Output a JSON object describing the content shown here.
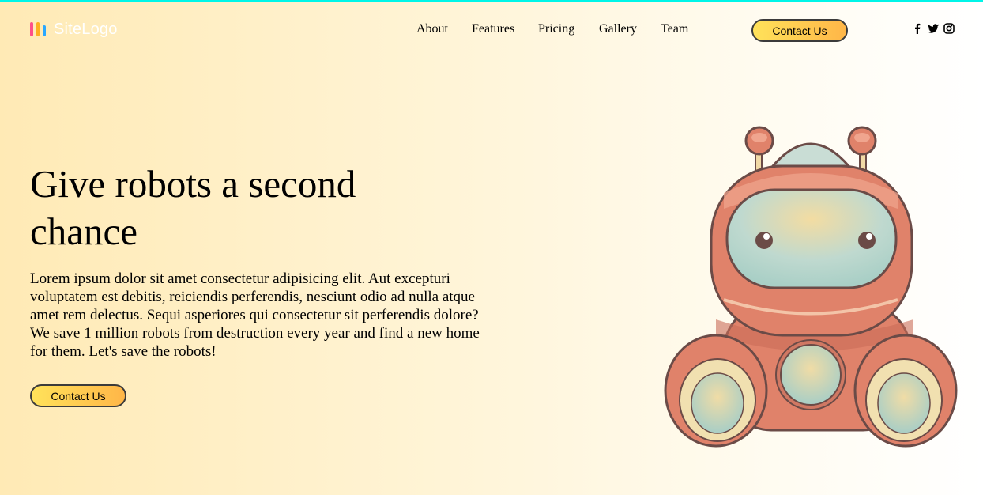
{
  "header": {
    "logo_text": "SiteLogo",
    "nav": [
      "About",
      "Features",
      "Pricing",
      "Gallery",
      "Team"
    ],
    "cta_label": "Contact Us",
    "social_icons": [
      "facebook-icon",
      "twitter-icon",
      "instagram-icon"
    ]
  },
  "hero": {
    "title": "Give robots a second chance",
    "description": "Lorem ipsum dolor sit amet consectetur adipisicing elit. Aut excepturi voluptatem est debitis, reiciendis perferendis, nesciunt odio ad nulla atque amet rem delectus. Sequi asperiores qui consectetur sit perferendis dolore? We save 1 million robots from destruction every year and find a new home for them. Let's save the robots!",
    "cta_label": "Contact Us"
  },
  "colors": {
    "top_border": "#00f5e8",
    "button_start": "#ffe25a",
    "button_end": "#ffb648",
    "robot_body": "#e0826a",
    "robot_visor": "#b8d8cf"
  }
}
